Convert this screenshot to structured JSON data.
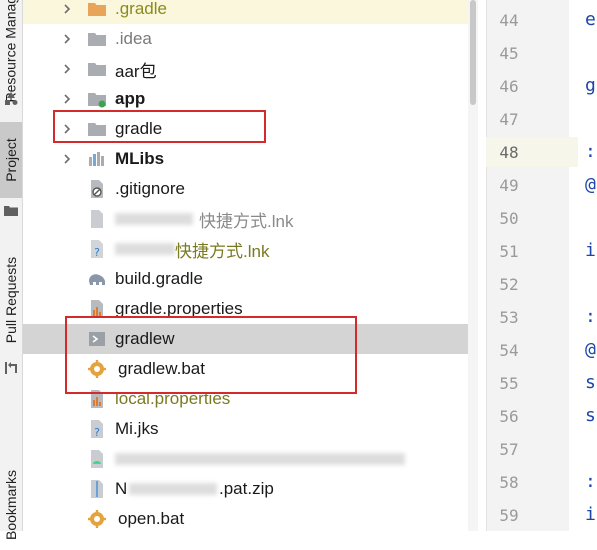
{
  "tool_strip": {
    "tabs": [
      {
        "label": "Resource Manager",
        "state": "inactive"
      },
      {
        "label": "Project",
        "state": "active"
      },
      {
        "label": "Pull Requests",
        "state": "inactive"
      },
      {
        "label": "Bookmarks",
        "state": "inactive"
      }
    ]
  },
  "tree": {
    "items": [
      {
        "label": ".gradle",
        "kind": "folder-orange",
        "expandable": true
      },
      {
        "label": ".idea",
        "kind": "folder",
        "expandable": true
      },
      {
        "label": "aar包",
        "kind": "folder",
        "expandable": true
      },
      {
        "label": "app",
        "kind": "module-folder",
        "expandable": true,
        "bold": true
      },
      {
        "label": "gradle",
        "kind": "folder",
        "expandable": true
      },
      {
        "label": "MLibs",
        "kind": "library-folder",
        "expandable": true,
        "bold": true
      },
      {
        "label": ".gitignore",
        "kind": "ignore-file"
      },
      {
        "label": "快捷方式.lnk",
        "kind": "unknown-file",
        "blurred_prefix": "01kaya"
      },
      {
        "label": "快捷方式.lnk",
        "kind": "unknown-file",
        "blurred_prefix": "blurred"
      },
      {
        "label": "build.gradle",
        "kind": "gradle-file"
      },
      {
        "label": "gradle.properties",
        "kind": "properties-file"
      },
      {
        "label": "gradlew",
        "kind": "script-file",
        "selected": true
      },
      {
        "label": "gradlew.bat",
        "kind": "bat-file"
      },
      {
        "label": "local.properties",
        "kind": "properties-file"
      },
      {
        "label": "Mi.jks",
        "kind": "unknown-file"
      },
      {
        "label": "",
        "kind": "android-file",
        "blurred_prefix": "blurred"
      },
      {
        "label": ".pat.zip",
        "kind": "zip-file",
        "blurred_prefix": "N"
      },
      {
        "label": "open.bat",
        "kind": "bat-file"
      }
    ]
  },
  "gutter": {
    "line_numbers": [
      "44",
      "45",
      "46",
      "47",
      "48",
      "49",
      "50",
      "51",
      "52",
      "53",
      "54",
      "55",
      "56",
      "57",
      "58",
      "59"
    ],
    "current_line": "48"
  },
  "editor": {
    "chars": [
      "e",
      "",
      "g",
      "",
      ":",
      "@",
      "",
      "i",
      "",
      ":",
      "@",
      "s",
      "s",
      "",
      ":",
      "i"
    ]
  },
  "colors": {
    "highlight_box": "#d22b2b",
    "selection": "#d4d4d4",
    "code_keyword": "#1b46a8"
  }
}
